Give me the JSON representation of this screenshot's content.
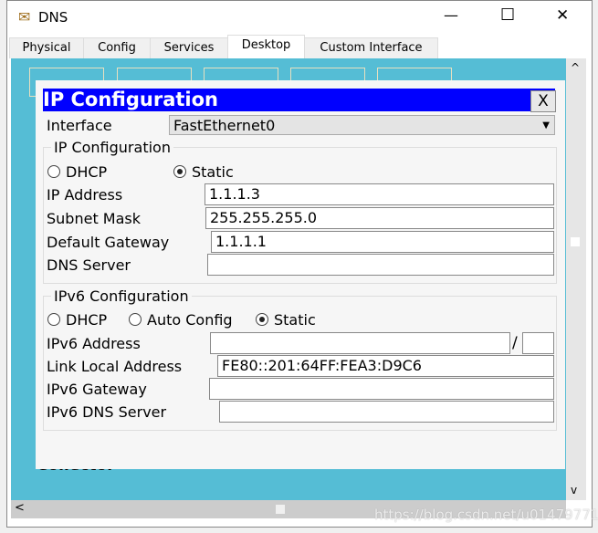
{
  "window": {
    "title": "DNS",
    "minimize": "—",
    "maximize": "☐",
    "close": "✕"
  },
  "tabs": [
    "Physical",
    "Config",
    "Services",
    "Desktop",
    "Custom Interface"
  ],
  "active_tab": "Desktop",
  "background_text": "Collector",
  "dialog": {
    "title": "IP Configuration",
    "close_label": "X",
    "interface_label": "Interface",
    "interface_value": "FastEthernet0",
    "ipv4": {
      "group_label": "IP Configuration",
      "dhcp": "DHCP",
      "static": "Static",
      "selected": "Static",
      "ip_label": "IP Address",
      "ip": "1.1.1.3",
      "mask_label": "Subnet Mask",
      "mask": "255.255.255.0",
      "gw_label": "Default Gateway",
      "gw": "1.1.1.1",
      "dns_label": "DNS Server",
      "dns": ""
    },
    "ipv6": {
      "group_label": "IPv6 Configuration",
      "dhcp": "DHCP",
      "auto": "Auto Config",
      "static": "Static",
      "selected": "Static",
      "addr_label": "IPv6 Address",
      "addr": "",
      "slash": "/",
      "prefix": "",
      "link_label": "Link Local Address",
      "link": "FE80::201:64FF:FEA3:D9C6",
      "gw_label": "IPv6 Gateway",
      "gw": "",
      "dns_label": "IPv6 DNS Server",
      "dns": ""
    }
  },
  "watermark": "https://blog.csdn.net/u014797713"
}
